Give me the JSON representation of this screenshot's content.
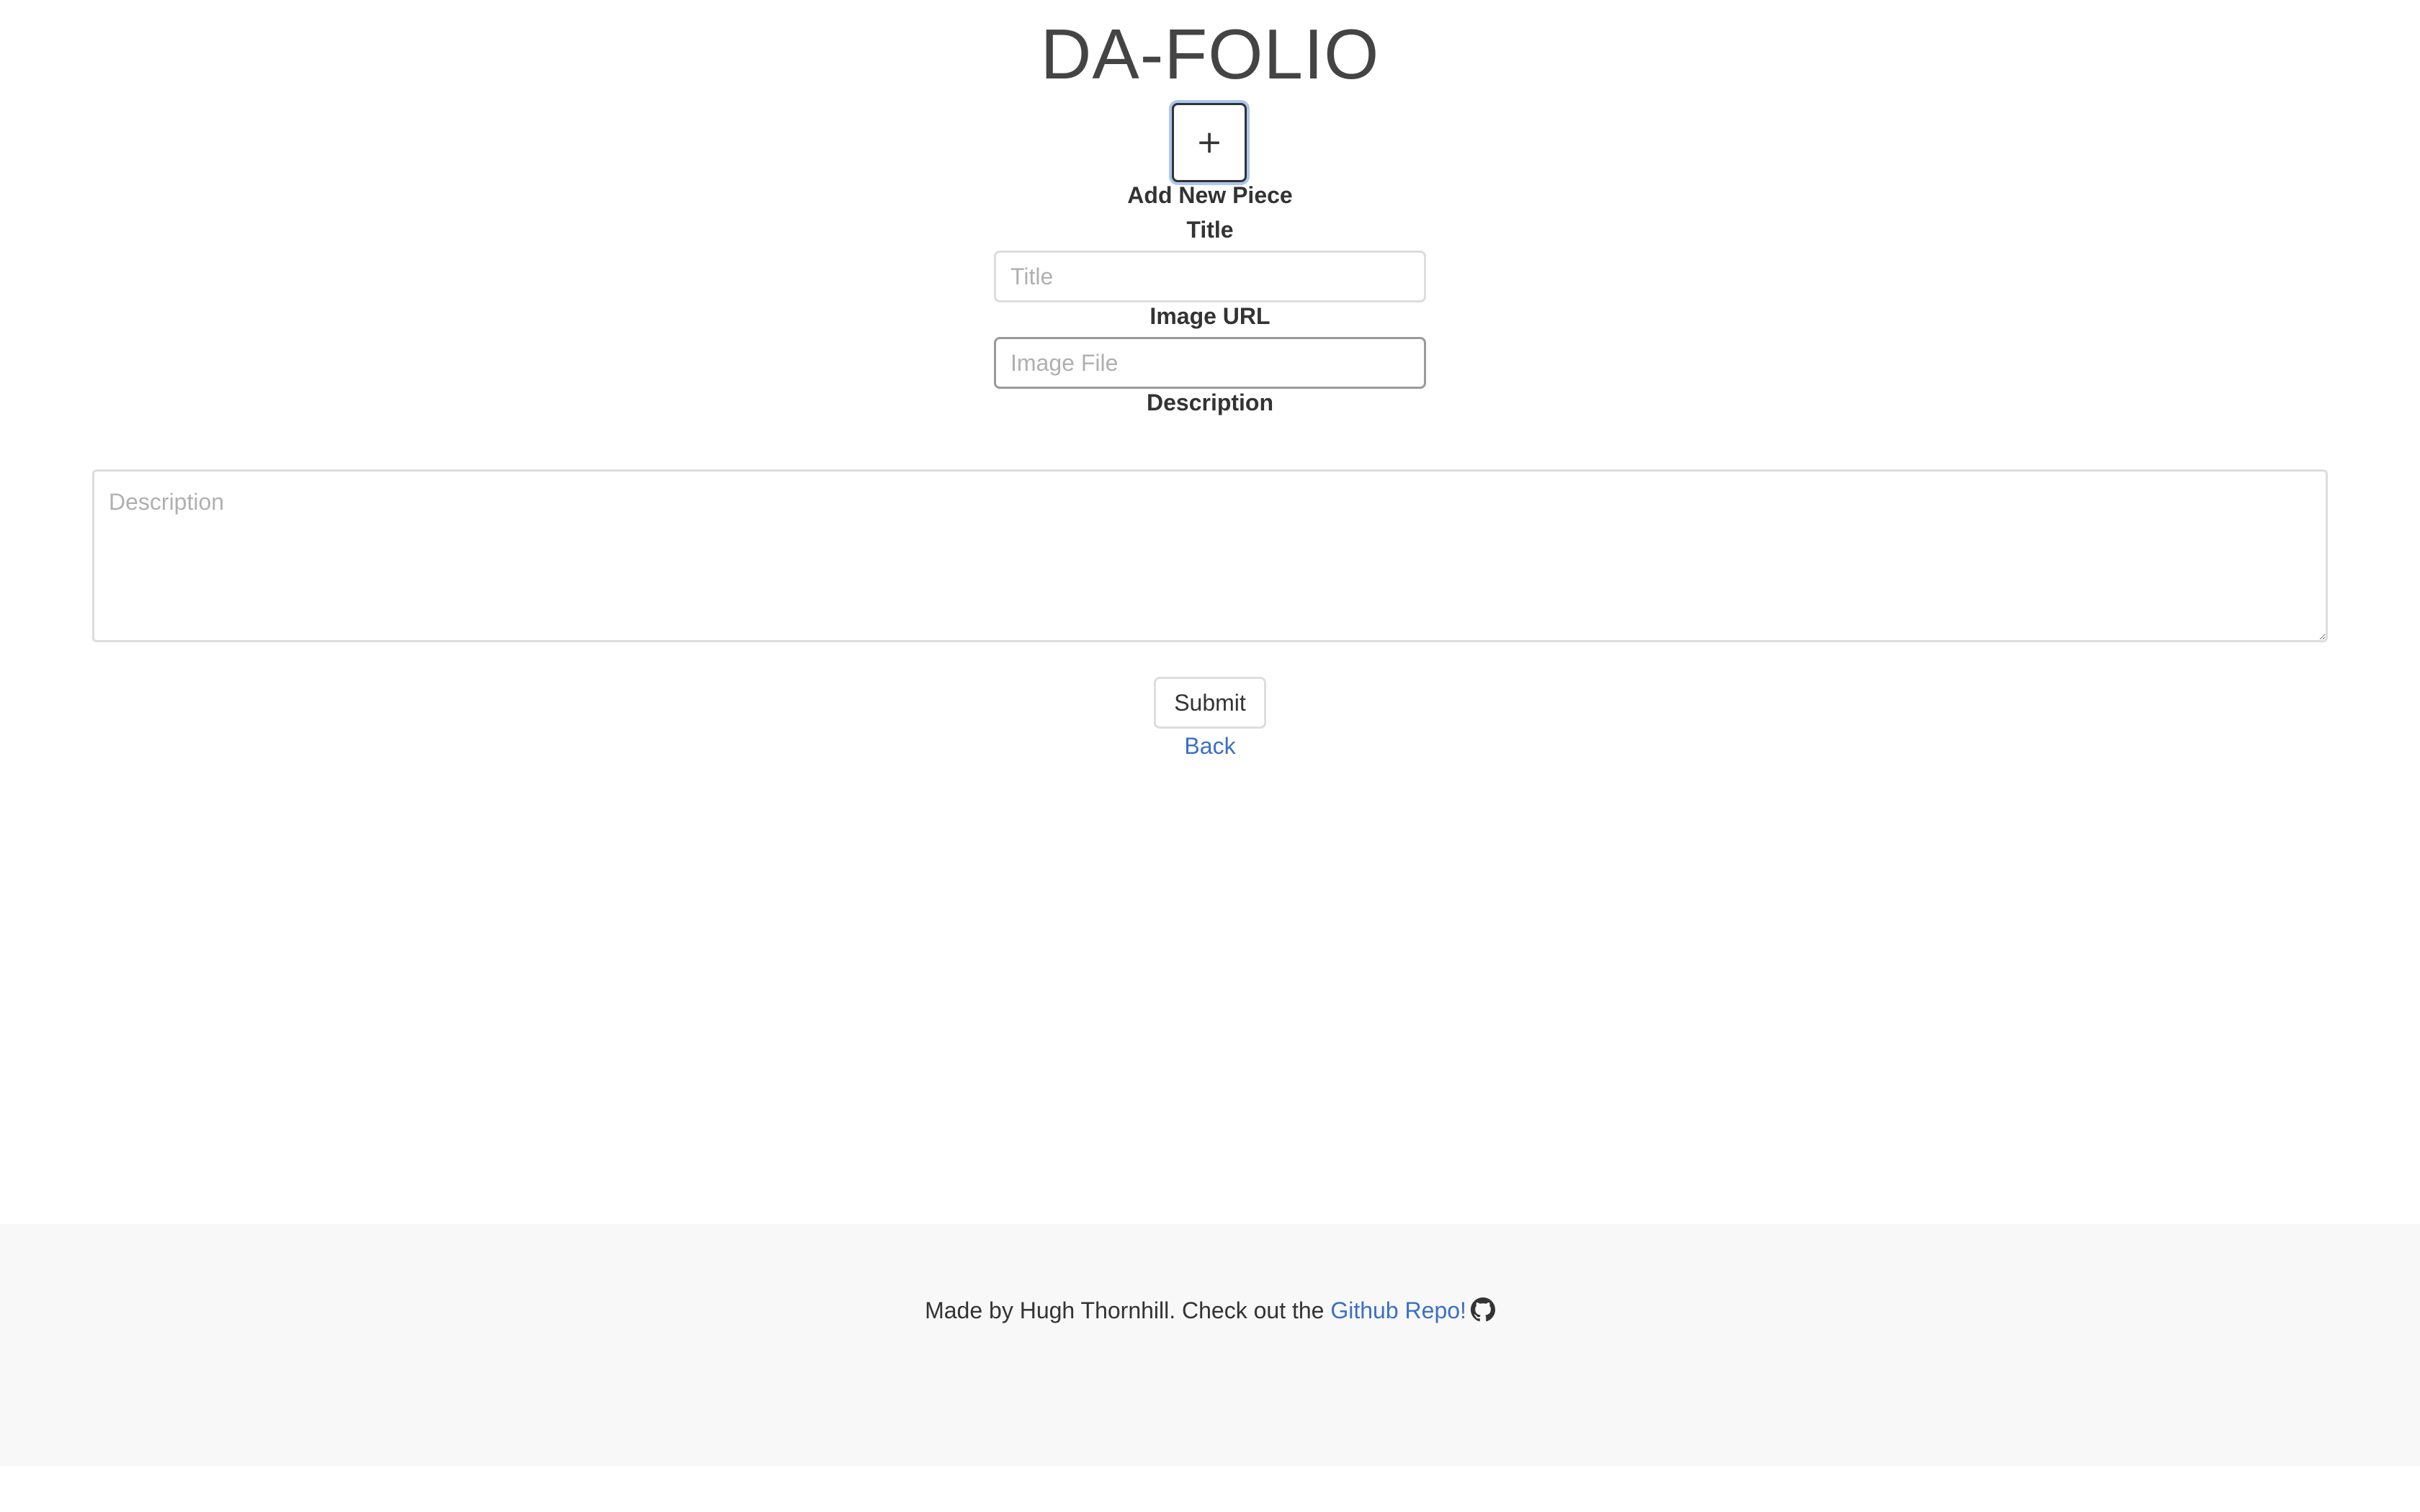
{
  "header": {
    "title": "DA-FOLIO"
  },
  "add_piece": {
    "button_label": "+",
    "heading": "Add New Piece"
  },
  "form": {
    "title_label": "Title",
    "title_placeholder": "Title",
    "title_value": "",
    "image_label": "Image URL",
    "image_placeholder": "Image File",
    "image_value": "",
    "description_label": "Description",
    "description_placeholder": "Description",
    "description_value": "",
    "submit_label": "Submit",
    "back_label": "Back"
  },
  "footer": {
    "text": "Made by Hugh Thornhill. Check out the ",
    "link_text": "Github Repo!",
    "icon": "github-icon"
  },
  "colors": {
    "link": "#3b6fc6",
    "footer_bg": "#f8f8f8",
    "focus_ring": "#a9c6ef"
  }
}
